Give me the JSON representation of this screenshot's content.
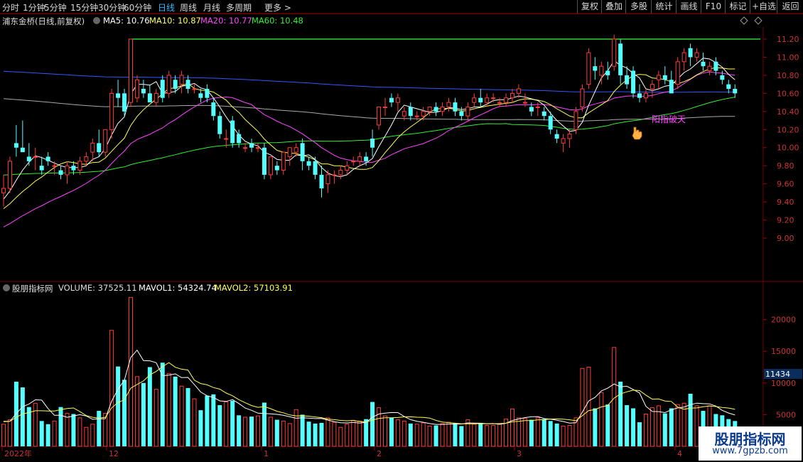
{
  "toolbar": {
    "periods": [
      "分时",
      "1分钟",
      "5分钟",
      "15分钟",
      "30分钟",
      "60分钟",
      "日线",
      "周线",
      "月线",
      "多周期",
      "更多 >"
    ],
    "active_period": "日线",
    "right_buttons": [
      "复权",
      "叠加",
      "多股",
      "统计",
      "画线",
      "F10",
      "标记",
      "+自选",
      "返回"
    ]
  },
  "main_info": {
    "stock": "浦东金桥(日线,前复权)",
    "ma5": "MA5: 10.76",
    "ma10": "MA10: 10.87",
    "ma20": "MA20: 10.77",
    "ma60": "MA60: 10.48"
  },
  "vol_info": {
    "name": "股朋指标网",
    "volume": "VOLUME: 37525.11",
    "mavol1": "MAVOL1: 54324.74",
    "mavol2": "MAVOL2: 57103.91"
  },
  "annotation": "一阳指破天",
  "price_axis": [
    "11.20",
    "11.00",
    "10.80",
    "10.60",
    "10.40",
    "10.20",
    "10.00",
    "9.80",
    "9.60",
    "9.40",
    "9.20",
    "9.00"
  ],
  "vol_axis": [
    "20000",
    "15000",
    "10000",
    "5000"
  ],
  "vol_current_label": "11434",
  "date_labels": [
    "2022年",
    "12",
    "1",
    "2",
    "3",
    "4"
  ],
  "colors": {
    "up": "#ff3c3c",
    "down": "#54ffff",
    "ma5": "#ffffff",
    "ma10": "#ffff55",
    "ma20": "#ff44ff",
    "ma60": "#33ee33",
    "ma120": "#aaaaaa",
    "ma250": "#3355ff",
    "hline": "#33ff33"
  },
  "watermark": {
    "title": "股朋指标网",
    "url": "www.7gpzb.com"
  },
  "chart_data": {
    "type": "candlestick",
    "hline": 11.2,
    "price_ylim": [
      9.0,
      11.3
    ],
    "vol_ylim": [
      0,
      25000
    ],
    "candles": [
      [
        9.5,
        9.7,
        9.35,
        9.55,
        3500
      ],
      [
        9.55,
        9.9,
        9.5,
        9.85,
        4200
      ],
      [
        10.05,
        10.25,
        9.9,
        10.0,
        10200
      ],
      [
        10.0,
        10.3,
        9.95,
        9.95,
        9300
      ],
      [
        9.9,
        10.05,
        9.8,
        9.85,
        6200
      ],
      [
        9.9,
        10.0,
        9.75,
        9.9,
        6800
      ],
      [
        9.8,
        9.9,
        9.7,
        9.75,
        4000
      ],
      [
        9.9,
        9.95,
        9.8,
        9.85,
        3500
      ],
      [
        9.8,
        9.85,
        9.7,
        9.8,
        4000
      ],
      [
        9.75,
        9.8,
        9.65,
        9.7,
        6200
      ],
      [
        9.7,
        9.85,
        9.6,
        9.8,
        5200
      ],
      [
        9.8,
        9.85,
        9.7,
        9.75,
        5100
      ],
      [
        9.75,
        9.9,
        9.7,
        9.85,
        4500
      ],
      [
        9.85,
        9.95,
        9.8,
        9.9,
        3000
      ],
      [
        9.95,
        10.1,
        9.85,
        10.05,
        3500
      ],
      [
        10.05,
        10.2,
        9.9,
        9.95,
        5600
      ],
      [
        9.95,
        10.2,
        9.9,
        10.2,
        5200
      ],
      [
        10.2,
        10.65,
        10.1,
        10.6,
        18300
      ],
      [
        10.6,
        10.75,
        10.45,
        10.55,
        12600
      ],
      [
        10.6,
        10.65,
        10.35,
        10.4,
        10500
      ],
      [
        10.5,
        11.2,
        10.45,
        11.2,
        23500
      ],
      [
        10.55,
        10.8,
        10.5,
        10.75,
        11000
      ],
      [
        10.65,
        10.75,
        10.55,
        10.6,
        10000
      ],
      [
        10.6,
        10.7,
        10.5,
        10.5,
        12500
      ],
      [
        10.5,
        10.65,
        10.45,
        10.6,
        9000
      ],
      [
        10.75,
        10.8,
        10.5,
        10.55,
        13200
      ],
      [
        10.6,
        10.85,
        10.55,
        10.8,
        11500
      ],
      [
        10.75,
        10.8,
        10.6,
        10.65,
        11000
      ],
      [
        10.7,
        10.85,
        10.6,
        10.8,
        9500
      ],
      [
        10.75,
        10.8,
        10.6,
        10.65,
        9200
      ],
      [
        10.65,
        10.7,
        10.6,
        10.65,
        7500
      ],
      [
        10.6,
        10.65,
        10.5,
        10.55,
        5700
      ],
      [
        10.65,
        10.7,
        10.5,
        10.55,
        8000
      ],
      [
        10.5,
        10.55,
        10.3,
        10.35,
        8200
      ],
      [
        10.35,
        10.4,
        10.1,
        10.15,
        6500
      ],
      [
        10.1,
        10.2,
        10.0,
        10.1,
        7000
      ],
      [
        10.3,
        10.35,
        10.0,
        10.05,
        7200
      ],
      [
        10.15,
        10.2,
        10.0,
        10.05,
        4900
      ],
      [
        10.0,
        10.05,
        9.95,
        10.0,
        4600
      ],
      [
        10.05,
        10.1,
        9.95,
        10.0,
        4700
      ],
      [
        10.0,
        10.05,
        9.95,
        10.0,
        4800
      ],
      [
        10.0,
        10.05,
        9.65,
        9.7,
        6900
      ],
      [
        9.7,
        9.9,
        9.65,
        9.9,
        4600
      ],
      [
        9.8,
        9.85,
        9.7,
        9.75,
        4200
      ],
      [
        9.75,
        9.95,
        9.7,
        9.95,
        4000
      ],
      [
        9.9,
        10.0,
        9.8,
        10.0,
        3600
      ],
      [
        9.95,
        10.05,
        9.9,
        10.0,
        5800
      ],
      [
        10.05,
        10.1,
        9.75,
        9.85,
        5000
      ],
      [
        9.85,
        9.9,
        9.75,
        9.8,
        3900
      ],
      [
        9.85,
        9.9,
        9.65,
        9.7,
        3600
      ],
      [
        9.7,
        9.8,
        9.45,
        9.55,
        3700
      ],
      [
        9.6,
        9.75,
        9.5,
        9.7,
        4500
      ],
      [
        9.7,
        9.75,
        9.6,
        9.7,
        3800
      ],
      [
        9.7,
        9.8,
        9.65,
        9.75,
        3000
      ],
      [
        9.75,
        9.85,
        9.7,
        9.8,
        3500
      ],
      [
        9.85,
        9.9,
        9.8,
        9.85,
        4100
      ],
      [
        9.85,
        9.95,
        9.8,
        9.9,
        4000
      ],
      [
        9.9,
        9.95,
        9.8,
        9.85,
        4300
      ],
      [
        10.1,
        10.2,
        9.9,
        10.0,
        7000
      ],
      [
        10.25,
        10.45,
        10.2,
        10.45,
        6100
      ],
      [
        10.45,
        10.55,
        10.35,
        10.45,
        4800
      ],
      [
        10.55,
        10.6,
        10.45,
        10.5,
        4500
      ],
      [
        10.5,
        10.6,
        10.4,
        10.55,
        4200
      ],
      [
        10.35,
        10.45,
        10.3,
        10.4,
        4000
      ],
      [
        10.45,
        10.5,
        10.3,
        10.35,
        3600
      ],
      [
        10.35,
        10.4,
        10.3,
        10.35,
        3500
      ],
      [
        10.35,
        10.45,
        10.3,
        10.4,
        3700
      ],
      [
        10.4,
        10.45,
        10.35,
        10.45,
        3200
      ],
      [
        10.45,
        10.5,
        10.35,
        10.4,
        3300
      ],
      [
        10.4,
        10.5,
        10.35,
        10.45,
        3600
      ],
      [
        10.45,
        10.55,
        10.4,
        10.5,
        3800
      ],
      [
        10.5,
        10.55,
        10.35,
        10.4,
        3700
      ],
      [
        10.4,
        10.45,
        10.3,
        10.35,
        3200
      ],
      [
        10.35,
        10.5,
        10.3,
        10.45,
        4200
      ],
      [
        10.5,
        10.6,
        10.45,
        10.55,
        3500
      ],
      [
        10.55,
        10.65,
        10.45,
        10.5,
        3700
      ],
      [
        10.5,
        10.6,
        10.45,
        10.55,
        3300
      ],
      [
        10.55,
        10.6,
        10.5,
        10.55,
        3300
      ],
      [
        10.5,
        10.55,
        10.45,
        10.5,
        3600
      ],
      [
        10.5,
        10.6,
        10.45,
        10.55,
        4300
      ],
      [
        10.55,
        10.65,
        10.5,
        10.6,
        5900
      ],
      [
        10.6,
        10.7,
        10.55,
        10.65,
        4500
      ],
      [
        10.5,
        10.6,
        10.45,
        10.5,
        4400
      ],
      [
        10.45,
        10.5,
        10.35,
        10.4,
        4200
      ],
      [
        10.45,
        10.5,
        10.35,
        10.45,
        4500
      ],
      [
        10.4,
        10.45,
        10.3,
        10.35,
        4300
      ],
      [
        10.35,
        10.4,
        10.15,
        10.2,
        4000
      ],
      [
        10.15,
        10.2,
        10.05,
        10.1,
        3600
      ],
      [
        10.05,
        10.15,
        9.95,
        10.1,
        3200
      ],
      [
        10.1,
        10.2,
        10.0,
        10.15,
        3300
      ],
      [
        10.2,
        10.45,
        10.15,
        10.4,
        4500
      ],
      [
        10.45,
        10.7,
        10.4,
        10.65,
        12300
      ],
      [
        10.7,
        11.1,
        10.65,
        11.05,
        12500
      ],
      [
        10.9,
        11.0,
        10.75,
        10.85,
        6000
      ],
      [
        10.8,
        10.95,
        10.7,
        10.9,
        8500
      ],
      [
        10.85,
        10.95,
        10.75,
        10.8,
        6600
      ],
      [
        10.9,
        11.25,
        10.85,
        11.2,
        15600
      ],
      [
        11.15,
        11.2,
        10.7,
        10.8,
        10200
      ],
      [
        10.8,
        10.9,
        10.65,
        10.7,
        6500
      ],
      [
        10.85,
        10.9,
        10.55,
        10.6,
        6000
      ],
      [
        10.6,
        10.7,
        10.5,
        10.55,
        3800
      ],
      [
        10.55,
        10.65,
        10.5,
        10.6,
        5100
      ],
      [
        10.65,
        10.75,
        10.55,
        10.7,
        6100
      ],
      [
        10.75,
        10.85,
        10.65,
        10.8,
        6400
      ],
      [
        10.8,
        10.9,
        10.7,
        10.75,
        5200
      ],
      [
        10.75,
        10.85,
        10.65,
        10.6,
        6000
      ],
      [
        10.7,
        11.0,
        10.65,
        10.95,
        6600
      ],
      [
        10.95,
        11.1,
        10.85,
        11.05,
        6800
      ],
      [
        11.1,
        11.15,
        10.9,
        11.0,
        8300
      ],
      [
        11.0,
        11.1,
        10.95,
        11.05,
        6400
      ],
      [
        10.95,
        11.05,
        10.85,
        10.9,
        5600
      ],
      [
        10.85,
        10.95,
        10.8,
        10.9,
        6400
      ],
      [
        10.95,
        11.0,
        10.8,
        10.85,
        5100
      ],
      [
        10.8,
        10.85,
        10.7,
        10.75,
        4900
      ],
      [
        10.7,
        10.75,
        10.6,
        10.65,
        4300
      ],
      [
        10.65,
        10.7,
        10.55,
        10.6,
        4000
      ]
    ]
  }
}
